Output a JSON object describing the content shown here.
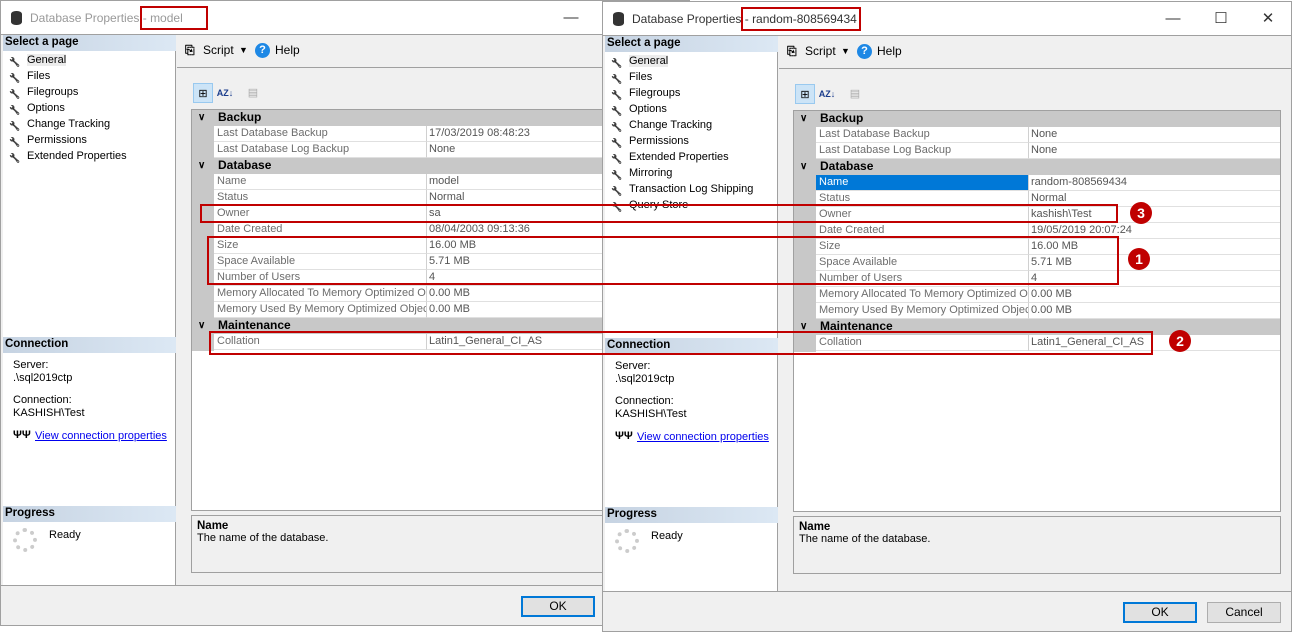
{
  "windows": [
    {
      "title_prefix": "Database Properties - ",
      "title_name": "model",
      "active": false,
      "select_page_header": "Select a page",
      "pages": [
        "General",
        "Files",
        "Filegroups",
        "Options",
        "Change Tracking",
        "Permissions",
        "Extended Properties"
      ],
      "selected_page": 0,
      "toolbar": {
        "script_label": "Script",
        "help_label": "Help"
      },
      "sections": [
        {
          "header": "Backup",
          "rows": [
            [
              "Last Database Backup",
              "17/03/2019 08:48:23"
            ],
            [
              "Last Database Log Backup",
              "None"
            ]
          ]
        },
        {
          "header": "Database",
          "rows": [
            [
              "Name",
              "model"
            ],
            [
              "Status",
              "Normal"
            ],
            [
              "Owner",
              "sa"
            ],
            [
              "Date Created",
              "08/04/2003 09:13:36"
            ],
            [
              "Size",
              "16.00 MB"
            ],
            [
              "Space Available",
              "5.71 MB"
            ],
            [
              "Number of Users",
              "4"
            ],
            [
              "Memory Allocated To Memory Optimized Ob",
              "0.00 MB"
            ],
            [
              "Memory Used By Memory Optimized Objects",
              "0.00 MB"
            ]
          ]
        },
        {
          "header": "Maintenance",
          "rows": [
            [
              "Collation",
              "Latin1_General_CI_AS"
            ]
          ]
        }
      ],
      "selected_row": null,
      "connection": {
        "header": "Connection",
        "server_label": "Server:",
        "server": ".\\sql2019ctp",
        "connection_label": "Connection:",
        "connection": "KASHISH\\Test",
        "link": "View connection properties"
      },
      "progress": {
        "header": "Progress",
        "status": "Ready"
      },
      "description": {
        "title": "Name",
        "text": "The name of the database."
      },
      "buttons": {
        "ok": "OK"
      }
    },
    {
      "title_prefix": "Database Properties - ",
      "title_name": "random-808569434",
      "active": true,
      "select_page_header": "Select a page",
      "pages": [
        "General",
        "Files",
        "Filegroups",
        "Options",
        "Change Tracking",
        "Permissions",
        "Extended Properties",
        "Mirroring",
        "Transaction Log Shipping",
        "Query Store"
      ],
      "selected_page": 0,
      "toolbar": {
        "script_label": "Script",
        "help_label": "Help"
      },
      "sections": [
        {
          "header": "Backup",
          "rows": [
            [
              "Last Database Backup",
              "None"
            ],
            [
              "Last Database Log Backup",
              "None"
            ]
          ]
        },
        {
          "header": "Database",
          "rows": [
            [
              "Name",
              "random-808569434"
            ],
            [
              "Status",
              "Normal"
            ],
            [
              "Owner",
              "kashish\\Test"
            ],
            [
              "Date Created",
              "19/05/2019 20:07:24"
            ],
            [
              "Size",
              "16.00 MB"
            ],
            [
              "Space Available",
              "5.71 MB"
            ],
            [
              "Number of Users",
              "4"
            ],
            [
              "Memory Allocated To Memory Optimized Ob",
              "0.00 MB"
            ],
            [
              "Memory Used By Memory Optimized Objects",
              "0.00 MB"
            ]
          ]
        },
        {
          "header": "Maintenance",
          "rows": [
            [
              "Collation",
              "Latin1_General_CI_AS"
            ]
          ]
        }
      ],
      "selected_row": "Name",
      "connection": {
        "header": "Connection",
        "server_label": "Server:",
        "server": ".\\sql2019ctp",
        "connection_label": "Connection:",
        "connection": "KASHISH\\Test",
        "link": "View connection properties"
      },
      "progress": {
        "header": "Progress",
        "status": "Ready"
      },
      "description": {
        "title": "Name",
        "text": "The name of the database."
      },
      "buttons": {
        "ok": "OK",
        "cancel": "Cancel"
      }
    }
  ],
  "annotations": [
    "1",
    "2",
    "3"
  ],
  "colors": {
    "annotation": "#c00000",
    "selection": "#0078d7",
    "link": "#0000ee"
  },
  "icons": {
    "window": "database-icon",
    "page": "wrench-icon",
    "script": "script-icon",
    "help": "help-icon",
    "categorized": "categorized-icon",
    "alphabetical": "sort-az-icon",
    "property_pages": "property-pages-icon",
    "connection": "plug-icon",
    "progress": "spinner-icon"
  }
}
